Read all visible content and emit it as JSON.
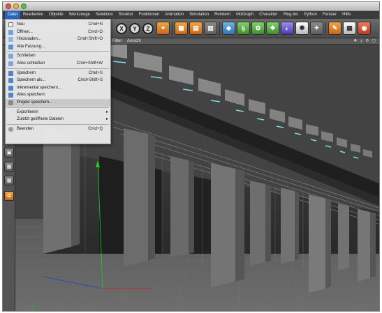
{
  "menubar": {
    "items": [
      "Datei",
      "Bearbeiten",
      "Objekte",
      "Werkzeuge",
      "Selektion",
      "Struktur",
      "Funktionen",
      "Animation",
      "Simulation",
      "Rendern",
      "MoGraph",
      "Charakter",
      "Plug-ins",
      "Python",
      "Fenster",
      "Hilfe"
    ]
  },
  "toolbar": {
    "axis_x": "X",
    "axis_y": "Y",
    "axis_z": "Z"
  },
  "viewport": {
    "menu_filter": "Filter",
    "menu_ansicht": "Ansicht",
    "nav_icons": "✥ ⇣ ⟳ ▢"
  },
  "file_menu": {
    "new": {
      "label": "Neu",
      "shortcut": "Cmd+N"
    },
    "open": {
      "label": "Öffnen...",
      "shortcut": "Cmd+O"
    },
    "merge": {
      "label": "Hinzuladen...",
      "shortcut": "Cmd+Shift+O"
    },
    "revert": {
      "label": "Alte Fassung..."
    },
    "close": {
      "label": "Schließen"
    },
    "close_all": {
      "label": "Alles schließen",
      "shortcut": "Cmd+Shift+W"
    },
    "save": {
      "label": "Speichern",
      "shortcut": "Cmd+S"
    },
    "save_as": {
      "label": "Speichern als...",
      "shortcut": "Cmd+Shift+S"
    },
    "save_incremental": {
      "label": "Inkremental speichern..."
    },
    "save_all": {
      "label": "Alles speichern"
    },
    "save_project": {
      "label": "Projekt speichern..."
    },
    "export": {
      "label": "Exportieren"
    },
    "recent": {
      "label": "Zuletzt geöffnete Dateien"
    },
    "quit": {
      "label": "Beenden",
      "shortcut": "Cmd+Q"
    }
  },
  "colors": {
    "menu_highlight": "#2a64c2",
    "viewport_bg": "#3e3e3e",
    "axis_x": "#cc2222",
    "axis_y": "#22cc22",
    "axis_z": "#2244cc"
  }
}
